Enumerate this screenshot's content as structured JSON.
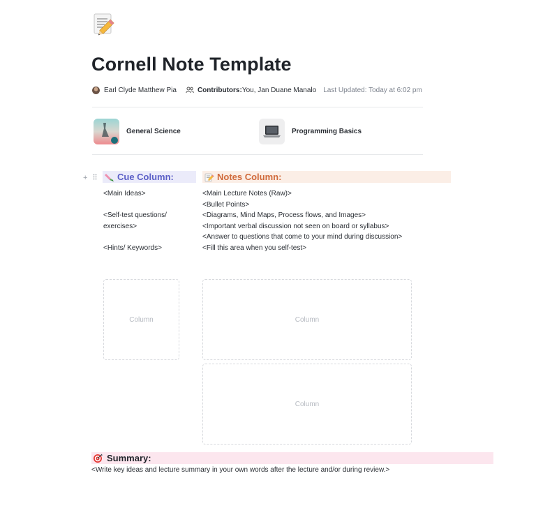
{
  "page": {
    "icon": "memo-pencil-icon",
    "title": "Cornell Note Template"
  },
  "meta": {
    "author": "Earl Clyde Matthew Pia",
    "contributors_label": "Contributors:",
    "contributors_value": " You, Jan Duane Manalo",
    "last_updated": "Last Updated: Today at 6:02 pm"
  },
  "linked_docs": [
    {
      "label": "General Science",
      "icon": "science-thumbnail"
    },
    {
      "label": "Programming Basics",
      "icon": "laptop-icon"
    }
  ],
  "cue": {
    "heading": "Cue Column:",
    "icon": "pencil-leaf-icon",
    "lines": [
      "<Main Ideas>",
      "",
      "<Self-test questions/ exercises>",
      "",
      "<Hints/ Keywords>"
    ],
    "placeholder": "Column"
  },
  "notes": {
    "heading": "Notes Column:",
    "icon": "memo-icon",
    "lines": [
      "<Main Lecture Notes (Raw)>",
      "<Bullet Points>",
      "<Diagrams, Mind Maps, Process flows, and Images>",
      "<Important verbal discussion not seen on board or syllabus>",
      "<Answer to questions that come to your mind during discussion>",
      "<Fill this area when you self-test>"
    ],
    "placeholder_top": "Column",
    "placeholder_bottom": "Column"
  },
  "summary": {
    "heading": "Summary:",
    "icon": "target-icon",
    "body": "<Write key ideas and lecture summary in your own words after the lecture and/or during review.>"
  },
  "colors": {
    "cue_bg": "#ebebfa",
    "cue_text": "#5b5fc7",
    "notes_bg": "#fbeee6",
    "notes_text": "#d06a3b",
    "summary_bg": "#fce6ee"
  }
}
